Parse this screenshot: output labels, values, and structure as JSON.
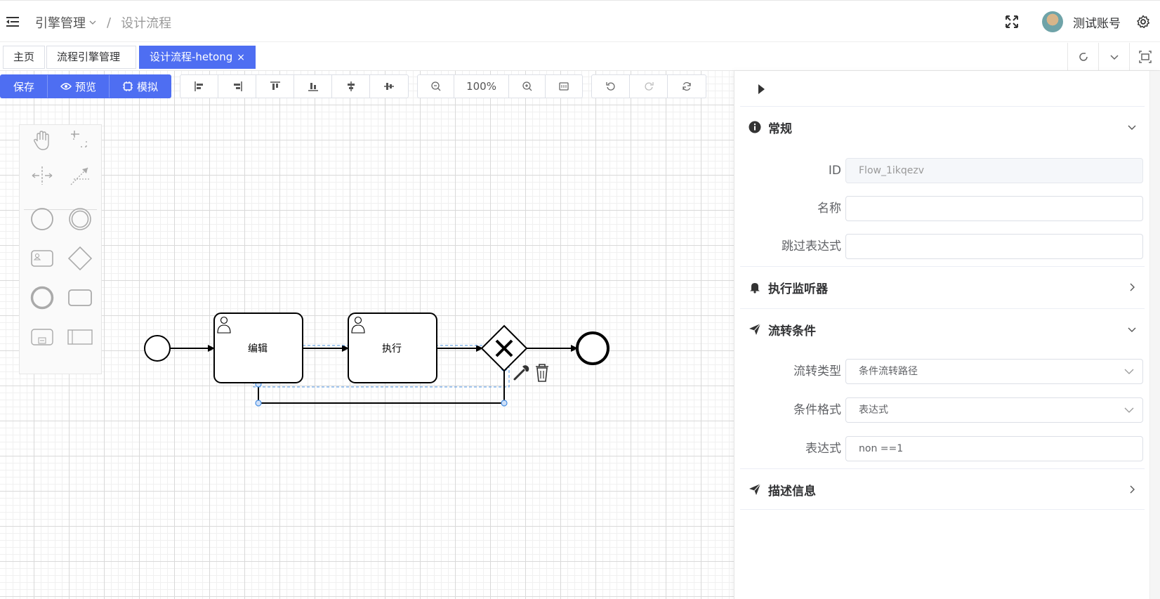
{
  "header": {
    "breadcrumb_first": "引擎管理",
    "breadcrumb_current": "设计流程",
    "username": "测试账号"
  },
  "tags": [
    {
      "label": "主页",
      "active": false
    },
    {
      "label": "流程引擎管理",
      "active": false
    },
    {
      "label": "设计流程-hetong",
      "active": true
    }
  ],
  "toolbar": {
    "save": "保存",
    "preview": "预览",
    "simulate": "模拟",
    "zoom": "100%"
  },
  "diagram": {
    "tasks": [
      {
        "label": "编辑"
      },
      {
        "label": "执行"
      }
    ],
    "gateway_symbol": "X"
  },
  "panel": {
    "sections": {
      "general": "常规",
      "listeners": "执行监听器",
      "condition": "流转条件",
      "description": "描述信息"
    },
    "fields": {
      "id_label": "ID",
      "id_value": "Flow_1ikqezv",
      "name_label": "名称",
      "name_value": "",
      "skip_label": "跳过表达式",
      "skip_value": "",
      "flow_type_label": "流转类型",
      "flow_type_value": "条件流转路径",
      "cond_format_label": "条件格式",
      "cond_format_value": "表达式",
      "expression_label": "表达式",
      "expression_value": "non ==1"
    }
  },
  "colors": {
    "primary": "#4e6ef2",
    "selection": "#4a90e2"
  }
}
